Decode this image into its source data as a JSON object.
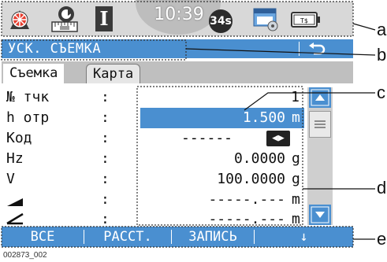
{
  "status_bar": {
    "icons": [
      "measure-target-icon",
      "level-tilt-icon",
      "face-indicator-icon",
      "prism-constant-icon",
      "card-memory-icon",
      "battery-icon"
    ],
    "time": "10:39",
    "face_label": "I",
    "prism_value": "34s",
    "battery_label": "T$"
  },
  "title_bar": {
    "title": "УСК. СЪЕМКА",
    "back_icon": "back-arrow-icon"
  },
  "tabs": [
    {
      "label": "Съемка",
      "active": true
    },
    {
      "label": "Карта",
      "active": false
    }
  ],
  "form": {
    "rows": [
      {
        "label": "№ тчк",
        "colon": ":",
        "value": "1",
        "unit": ""
      },
      {
        "label": "h отр",
        "colon": ":",
        "value": "1.500",
        "unit": "m"
      },
      {
        "label": "Код",
        "colon": ":",
        "value": "------",
        "unit": ""
      },
      {
        "label": "Hz",
        "colon": ":",
        "value": "0.0000",
        "unit": "g"
      },
      {
        "label": "V",
        "colon": ":",
        "value": "100.0000",
        "unit": "g"
      },
      {
        "label": "",
        "colon": ":",
        "value": "-----.---",
        "unit": "m"
      },
      {
        "label": "",
        "colon": ":",
        "value": "-----.---",
        "unit": "m"
      }
    ],
    "row_icons": [
      "slope-distance-icon",
      "horizontal-distance-icon"
    ],
    "code_toggle_icon": "left-right-toggle-icon"
  },
  "softkeys": [
    "ВСЕ",
    "РАССТ.",
    "ЗАПИСЬ",
    "↓"
  ],
  "callouts": [
    "a",
    "b",
    "c",
    "d",
    "e"
  ],
  "figure_id": "002873_002",
  "colors": {
    "accent": "#4a8fd0",
    "status_bg": "#d8d8d8",
    "tab_bg": "#bfbfbf"
  }
}
